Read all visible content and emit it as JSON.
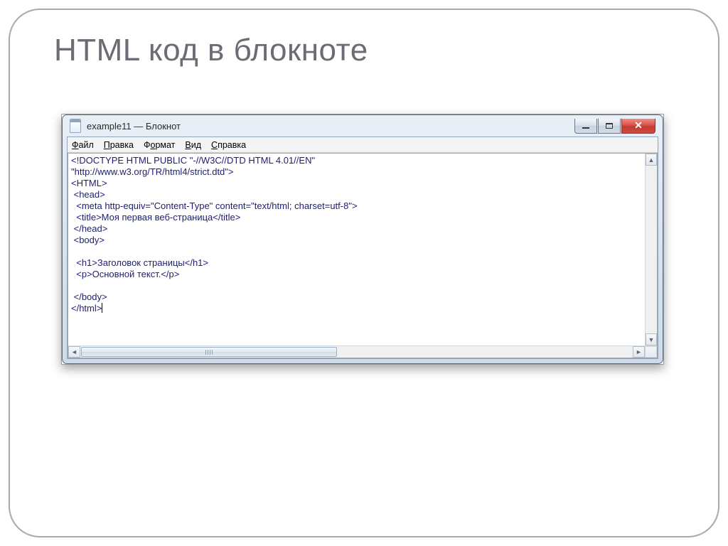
{
  "page": {
    "title": "HTML код  в блокноте"
  },
  "window": {
    "title": "example11 — Блокнот"
  },
  "menubar": {
    "file": "Файл",
    "edit": "Правка",
    "format": "Формат",
    "view": "Вид",
    "help": "Справка"
  },
  "editor": {
    "line1": "<!DOCTYPE HTML PUBLIC \"-//W3C//DTD HTML 4.01//EN\"",
    "line2": "\"http://www.w3.org/TR/html4/strict.dtd\">",
    "line3": "<HTML>",
    "line4": " <head>",
    "line5": "  <meta http-equiv=\"Content-Type\" content=\"text/html; charset=utf-8\">",
    "line6": "  <title>Моя первая веб-страница</title>",
    "line7": " </head>",
    "line8": " <body>",
    "line9": "",
    "line10": "  <h1>Заголовок страницы</h1>",
    "line11": "  <p>Основной текст.</p>",
    "line12": "",
    "line13": " </body>",
    "line14": "</html>"
  }
}
